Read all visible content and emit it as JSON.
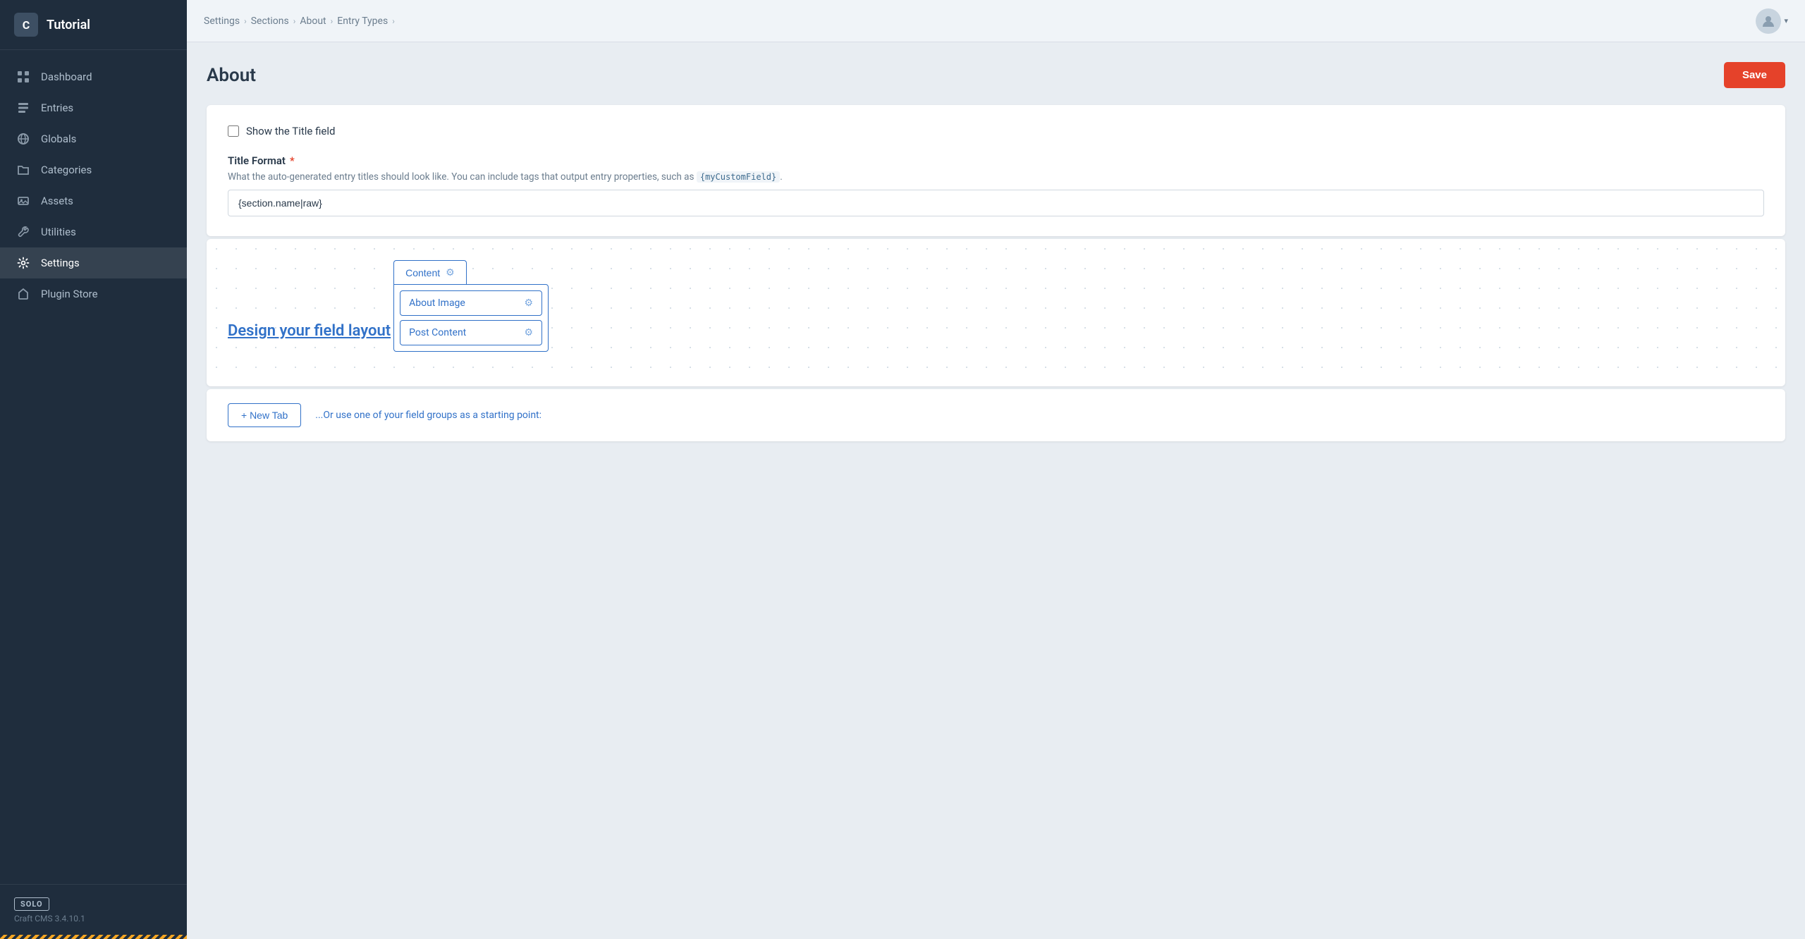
{
  "app": {
    "logo_letter": "C",
    "title": "Tutorial"
  },
  "sidebar": {
    "items": [
      {
        "id": "dashboard",
        "label": "Dashboard",
        "icon": "dashboard-icon",
        "active": false
      },
      {
        "id": "entries",
        "label": "Entries",
        "icon": "entries-icon",
        "active": false
      },
      {
        "id": "globals",
        "label": "Globals",
        "icon": "globals-icon",
        "active": false
      },
      {
        "id": "categories",
        "label": "Categories",
        "icon": "categories-icon",
        "active": false
      },
      {
        "id": "assets",
        "label": "Assets",
        "icon": "assets-icon",
        "active": false
      },
      {
        "id": "utilities",
        "label": "Utilities",
        "icon": "utilities-icon",
        "active": false
      },
      {
        "id": "settings",
        "label": "Settings",
        "icon": "settings-icon",
        "active": true
      },
      {
        "id": "plugin-store",
        "label": "Plugin Store",
        "icon": "plugin-store-icon",
        "active": false
      }
    ],
    "footer": {
      "badge": "SOLO",
      "version": "Craft CMS 3.4.10.1"
    }
  },
  "breadcrumb": {
    "items": [
      {
        "label": "Settings",
        "link": true
      },
      {
        "label": "Sections",
        "link": true
      },
      {
        "label": "About",
        "link": true
      },
      {
        "label": "Entry Types",
        "link": true
      }
    ]
  },
  "page": {
    "title": "About",
    "save_button": "Save"
  },
  "form": {
    "show_title_field_label": "Show the Title field",
    "title_format_label": "Title Format",
    "title_format_required": true,
    "title_format_hint": "What the auto-generated entry titles should look like. You can include tags that output entry properties, such as",
    "title_format_hint_code": "{myCustomField}",
    "title_format_value": "{section.name|raw}",
    "design_layout_link": "Design your field layout",
    "tab_name": "Content",
    "fields": [
      {
        "name": "About Image"
      },
      {
        "name": "Post Content"
      }
    ],
    "new_tab_button": "+ New Tab",
    "starting_point_text": "...Or use one of your field groups as a starting point:"
  }
}
